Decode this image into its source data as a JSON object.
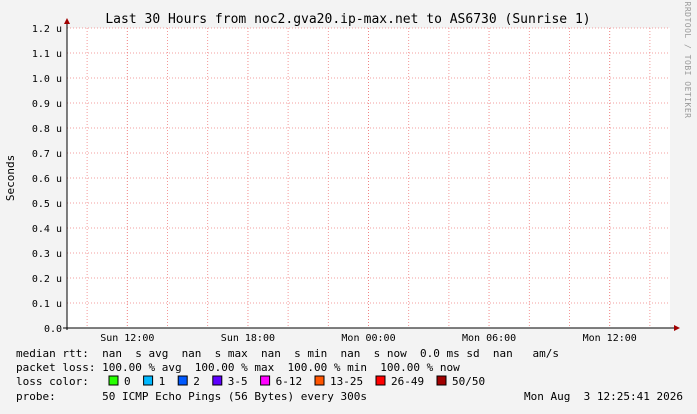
{
  "chart_data": {
    "type": "line",
    "title": "Last 30 Hours from noc2.gva20.ip-max.net to AS6730 (Sunrise 1)",
    "xlabel": "",
    "ylabel": "Seconds",
    "ylim": [
      0,
      1.2
    ],
    "y_ticks": [
      "0.0",
      "0.1 u",
      "0.2 u",
      "0.3 u",
      "0.4 u",
      "0.5 u",
      "0.6 u",
      "0.7 u",
      "0.8 u",
      "0.9 u",
      "1.0 u",
      "1.1 u",
      "1.2 u"
    ],
    "x_ticks": [
      "Sun 12:00",
      "Sun 18:00",
      "Mon 00:00",
      "Mon 06:00",
      "Mon 12:00"
    ],
    "grid": true,
    "series": []
  },
  "watermark": "RRDTOOL / TOBI OETIKER",
  "legend": {
    "median_rtt": "median rtt:  nan  s avg  nan  s max  nan  s min  nan  s now  0.0 ms sd  nan   am/s",
    "packet_loss": "packet loss: 100.00 % avg  100.00 % max  100.00 % min  100.00 % now",
    "loss_color_label": "loss color:",
    "loss_colors": [
      {
        "label": "0",
        "color": "#26ff00"
      },
      {
        "label": "1",
        "color": "#00b8ff"
      },
      {
        "label": "2",
        "color": "#0059ff"
      },
      {
        "label": "3-5",
        "color": "#5e00ff"
      },
      {
        "label": "6-12",
        "color": "#ff00ff"
      },
      {
        "label": "13-25",
        "color": "#ff5500"
      },
      {
        "label": "26-49",
        "color": "#ff0000"
      },
      {
        "label": "50/50",
        "color": "#a10000"
      }
    ],
    "probe": "probe:       50 ICMP Echo Pings (56 Bytes) every 300s",
    "timestamp": "Mon Aug  3 12:25:41 2026"
  }
}
